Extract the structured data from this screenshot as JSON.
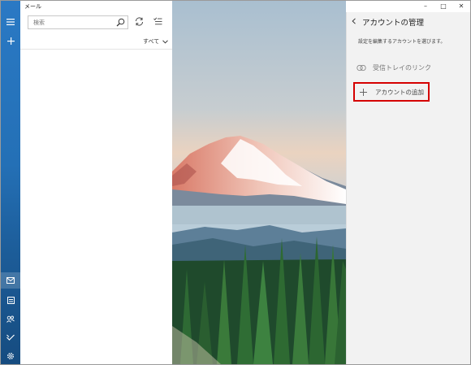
{
  "app": {
    "title": "メール"
  },
  "window": {
    "minimize": "–",
    "maximize": "□",
    "close": "✕"
  },
  "search": {
    "placeholder": "検索"
  },
  "list": {
    "filter_label": "すべて"
  },
  "settings": {
    "title": "アカウントの管理",
    "description": "設定を編集するアカウントを選びます。",
    "link_inboxes_label": "受信トレイのリンク",
    "add_account_label": "アカウントの追加"
  },
  "icons": {
    "hamburger": "hamburger-icon",
    "compose": "plus-icon",
    "mail": "mail-icon",
    "calendar": "calendar-icon",
    "people": "people-icon",
    "todo": "checkmark-icon",
    "settings": "gear-icon",
    "search": "search-icon",
    "sync": "sync-icon",
    "filter": "filter-icon",
    "back": "chevron-left-icon",
    "link": "link-icon",
    "add": "plus-icon"
  },
  "colors": {
    "rail": "#2470b6",
    "highlight_border": "#d50000",
    "settings_bg": "#f2f2f2"
  }
}
